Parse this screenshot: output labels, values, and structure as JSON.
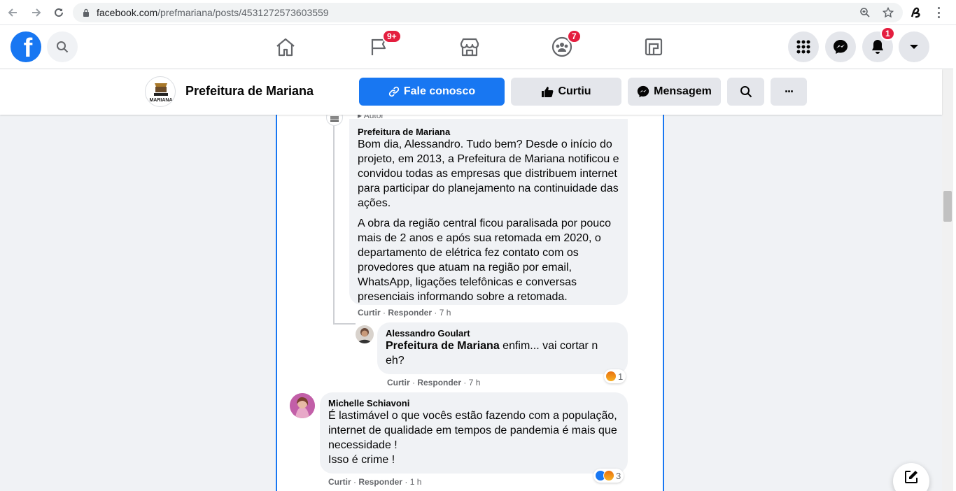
{
  "browser": {
    "url_host": "facebook.com",
    "url_path": "/prefmariana/posts/4531272573603559"
  },
  "fb_nav": {
    "groups_badge": "9+",
    "groups_icon": "flag-icon",
    "friends_badge": "7",
    "notifications_badge": "1"
  },
  "page": {
    "name": "Prefeitura de Mariana",
    "avatar_label": "MARIANA",
    "contact_label": "Fale conosco",
    "liked_label": "Curtiu",
    "message_label": "Mensagem",
    "more_label": "···"
  },
  "comments": {
    "author_tag": "Autor",
    "c1": {
      "name": "Prefeitura de Mariana",
      "p1": "Bom dia, Alessandro. Tudo bem? Desde o início do projeto, em 2013, a Prefeitura de Mariana notificou e convidou todas as empresas que distribuem internet para participar do planejamento na continuidade das ações.",
      "p2": "A obra da região central ficou paralisada por pouco mais de 2 anos e após sua retomada em 2020, o departamento de elétrica fez contato com os provedores que atuam na região por email, WhatsApp, ligações telefônicas e conversas presenciais informando sobre a retomada.",
      "like": "Curtir",
      "reply": "Responder",
      "time": "7 h"
    },
    "c2": {
      "name": "Alessandro Goulart",
      "mention": "Prefeitura de Mariana",
      "text": " enfim... vai cortar n eh?",
      "like": "Curtir",
      "reply": "Responder",
      "time": "7 h",
      "reaction_count": "1"
    },
    "c3": {
      "name": "Michelle Schiavoni",
      "line1": "É lastimável o que vocês estão fazendo com a população, internet de qualidade em tempos de pandemia é mais que necessidade !",
      "line2": "Isso é crime !",
      "like": "Curtir",
      "reply": "Responder",
      "time": "1 h",
      "reaction_count": "3"
    }
  },
  "colors": {
    "fb_blue": "#1877f2",
    "badge_red": "#e41e3f",
    "bubble": "#f0f2f5"
  }
}
